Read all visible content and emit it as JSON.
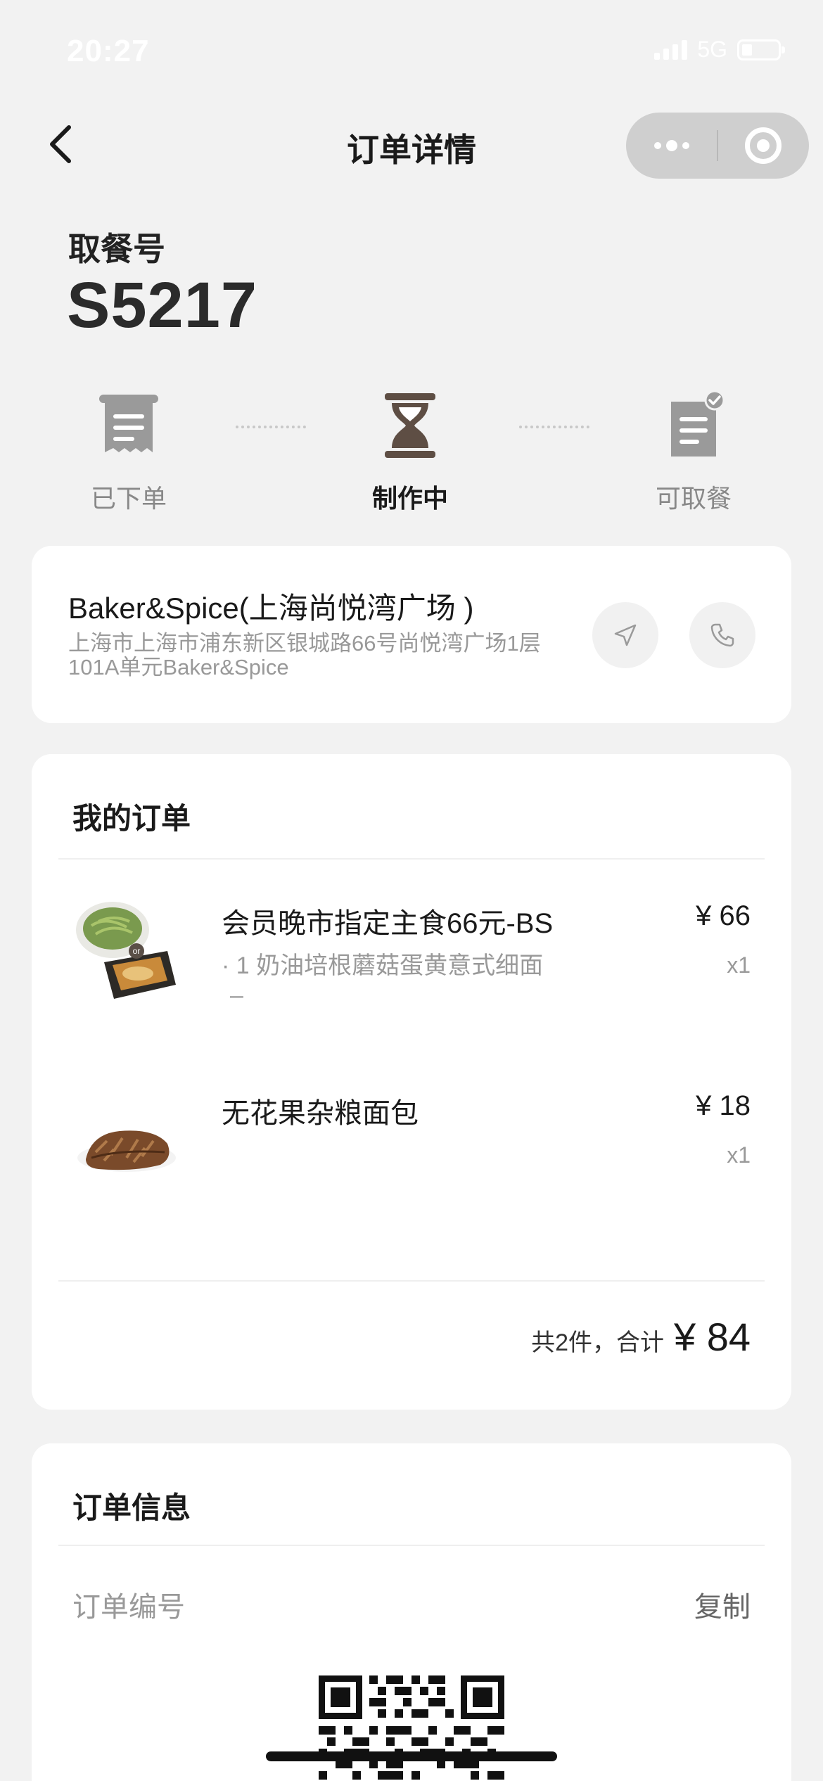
{
  "status_bar": {
    "time": "20:27",
    "network": "5G"
  },
  "nav": {
    "title": "订单详情"
  },
  "pickup": {
    "label": "取餐号",
    "number": "S5217"
  },
  "steps": [
    {
      "label": "已下单",
      "icon": "receipt-icon",
      "state": "done"
    },
    {
      "label": "制作中",
      "icon": "hourglass-icon",
      "state": "active"
    },
    {
      "label": "可取餐",
      "icon": "document-check-icon",
      "state": "pending"
    }
  ],
  "store": {
    "name": "Baker&Spice(上海尚悦湾广场 )",
    "address": "上海市上海市浦东新区银城路66号尚悦湾广场1层101A单元Baker&Spice"
  },
  "order": {
    "title": "我的订单",
    "items": [
      {
        "name": "会员晚市指定主食66元-BS",
        "option": "· 1 奶油培根蘑菇蛋黄意式细面",
        "option_extra": "–",
        "price": "¥ 66",
        "qty": "x1"
      },
      {
        "name": "无花果杂粮面包",
        "price": "¥ 18",
        "qty": "x1"
      }
    ],
    "summary_count": "共2件，合计",
    "summary_total": "¥ 84"
  },
  "info": {
    "title": "订单信息",
    "order_no_label": "订单编号",
    "copy_label": "复制"
  },
  "colors": {
    "background": "#f2f2f2",
    "card": "#ffffff",
    "active_step": "#5e4e44",
    "inactive_step": "#9a9a9a"
  }
}
